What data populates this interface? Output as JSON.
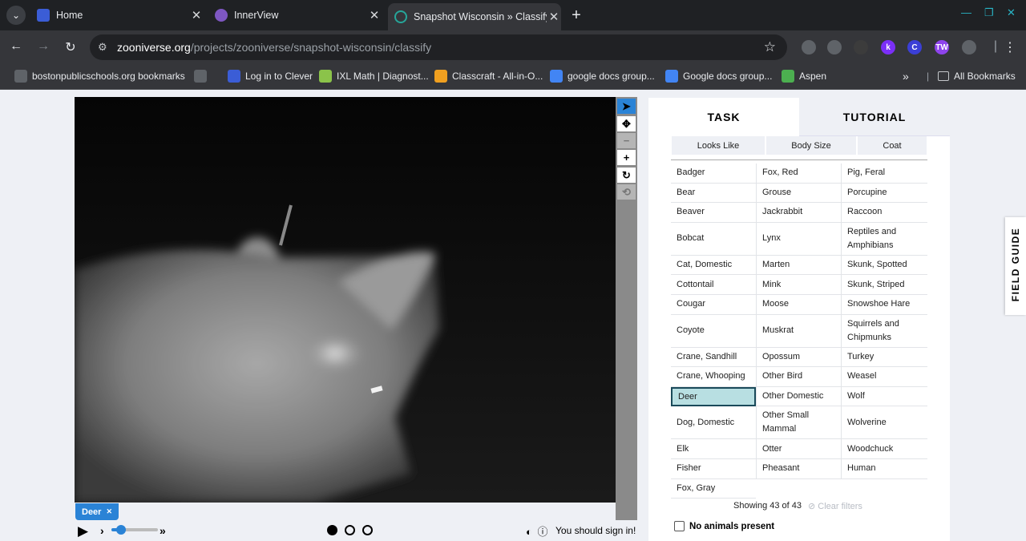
{
  "browser": {
    "tabs": [
      {
        "title": "Home",
        "favicon_color": "#3b5dd6"
      },
      {
        "title": "InnerView",
        "favicon_color": "#7e57c2"
      },
      {
        "title": "Snapshot Wisconsin » Classify",
        "favicon_color": "#26a69a"
      }
    ],
    "url_host": "zooniverse.org",
    "url_path": "/projects/zooniverse/snapshot-wisconsin/classify",
    "extensions": [
      {
        "name": "shield-icon",
        "color": "#5f6368",
        "label": ""
      },
      {
        "name": "shield-outline-icon",
        "color": "#5f6368",
        "label": ""
      },
      {
        "name": "power-icon",
        "color": "#3c3c3c",
        "label": ""
      },
      {
        "name": "k-extension-icon",
        "color": "#7b2ff7",
        "label": "k"
      },
      {
        "name": "c-extension-icon",
        "color": "#3b3fd6",
        "label": "C"
      },
      {
        "name": "tw-extension-icon",
        "color": "#8e44ec",
        "label": "TW"
      },
      {
        "name": "puzzle-icon",
        "color": "#5f6368",
        "label": ""
      }
    ],
    "bookmarks": [
      {
        "label": "bostonpublicschools.org bookmarks",
        "icon": "folder-icon",
        "color": "#5f6368"
      },
      {
        "label": "",
        "icon": "apps-grid-icon",
        "color": "#5f6368"
      },
      {
        "label": "Log in to Clever",
        "icon": "clever-icon",
        "color": "#3b5dd6"
      },
      {
        "label": "IXL Math | Diagnost...",
        "icon": "ixl-icon",
        "color": "#8bc34a"
      },
      {
        "label": "Classcraft - All-in-O...",
        "icon": "classcraft-icon",
        "color": "#f0a020"
      },
      {
        "label": "google docs group...",
        "icon": "docs-icon",
        "color": "#4285f4"
      },
      {
        "label": "Google docs group...",
        "icon": "docs-icon",
        "color": "#4285f4"
      },
      {
        "label": "Aspen",
        "icon": "aspen-icon",
        "color": "#4caf50"
      }
    ],
    "all_bookmarks": "All Bookmarks"
  },
  "classifier": {
    "species_tag": "Deer",
    "sign_in": "You should sign in!",
    "frames": [
      "on",
      "off",
      "off"
    ],
    "playback_speed": 0.2
  },
  "panel": {
    "task_tab": "TASK",
    "tutorial_tab": "TUTORIAL",
    "filters": [
      "Looks Like",
      "Body Size",
      "Coat"
    ],
    "columns": [
      [
        "Badger",
        "Bear",
        "Beaver",
        "Bobcat",
        "Cat, Domestic",
        "Cottontail",
        "Cougar",
        "Coyote",
        "Crane, Sandhill",
        "Crane, Whooping",
        "Deer",
        "Dog, Domestic",
        "Elk",
        "Fisher",
        "Fox, Gray"
      ],
      [
        "Fox, Red",
        "Grouse",
        "Jackrabbit",
        "Lynx",
        "Marten",
        "Mink",
        "Moose",
        "Muskrat",
        "Opossum",
        "Other Bird",
        "Other Domestic",
        "Other Small Mammal",
        "Otter",
        "Pheasant"
      ],
      [
        "Pig, Feral",
        "Porcupine",
        "Raccoon",
        "Reptiles and Amphibians",
        "Skunk, Spotted",
        "Skunk, Striped",
        "Snowshoe Hare",
        "Squirrels and Chipmunks",
        "Turkey",
        "Weasel",
        "Wolf",
        "Wolverine",
        "Woodchuck",
        "Human"
      ]
    ],
    "selected": "Deer",
    "showing": "Showing 43 of 43",
    "clear_filters": "Clear filters",
    "no_animals": "No animals present",
    "field_guide": "FIELD GUIDE"
  }
}
